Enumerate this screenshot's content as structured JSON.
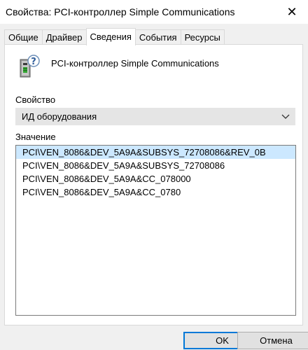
{
  "window": {
    "title": "Свойства: PCI-контроллер Simple Communications",
    "close_glyph": "✕"
  },
  "tabs": [
    {
      "label": "Общие",
      "active": false
    },
    {
      "label": "Драйвер",
      "active": false
    },
    {
      "label": "Сведения",
      "active": true
    },
    {
      "label": "События",
      "active": false
    },
    {
      "label": "Ресурсы",
      "active": false
    }
  ],
  "device": {
    "icon": "unknown-device-icon",
    "name": "PCI-контроллер Simple Communications"
  },
  "property": {
    "label": "Свойство",
    "selected": "ИД оборудования",
    "icon": "chevron-down-icon"
  },
  "value": {
    "label": "Значение",
    "items": [
      "PCI\\VEN_8086&DEV_5A9A&SUBSYS_72708086&REV_0B",
      "PCI\\VEN_8086&DEV_5A9A&SUBSYS_72708086",
      "PCI\\VEN_8086&DEV_5A9A&CC_078000",
      "PCI\\VEN_8086&DEV_5A9A&CC_0780"
    ],
    "selected_index": 0
  },
  "buttons": {
    "ok": "OK",
    "cancel": "Отмена"
  },
  "colors": {
    "accent": "#0078d7",
    "selection": "#cce8ff",
    "dialog_bg": "#f0f0f0"
  }
}
